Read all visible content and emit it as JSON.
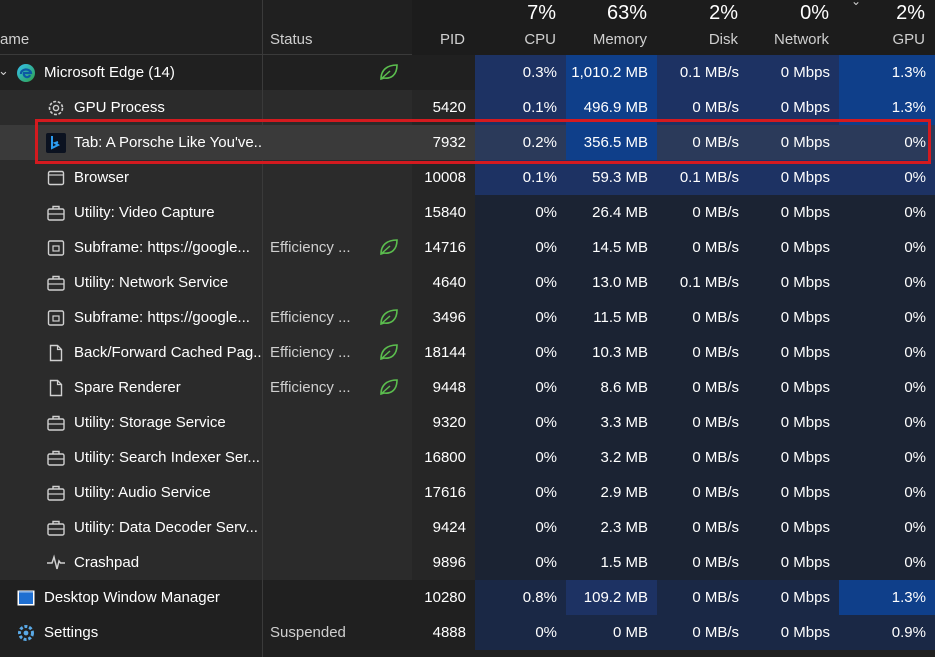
{
  "columns": {
    "name": {
      "label": "ame"
    },
    "status": {
      "label": "Status"
    },
    "pid": {
      "label": "PID"
    },
    "cpu": {
      "label": "CPU",
      "percent": "7%"
    },
    "memory": {
      "label": "Memory",
      "percent": "63%"
    },
    "disk": {
      "label": "Disk",
      "percent": "2%"
    },
    "network": {
      "label": "Network",
      "percent": "0%"
    },
    "gpu": {
      "label": "GPU",
      "percent": "2%"
    }
  },
  "colors": {
    "background": "#202020",
    "heat_light": "#1a2845",
    "heat_medium": "#1d3263",
    "heat_strong": "#0f3f8a",
    "highlight_box": "#d41a1f",
    "leaf_green": "#5bbd4e"
  },
  "processes": [
    {
      "name": "Microsoft Edge (14)",
      "status": "",
      "status_icon": "leaf-icon",
      "pid": "",
      "cpu": "0.3%",
      "memory": "1,010.2 MB",
      "disk": "0.1 MB/s",
      "network": "0 Mbps",
      "gpu": "1.3%",
      "icon": "edge-icon",
      "level": 0,
      "expanded": true,
      "heat": {
        "cpu": "medium",
        "memory": "strong",
        "disk": "medium",
        "network": "medium",
        "gpu": "strong"
      }
    },
    {
      "name": "GPU Process",
      "status": "",
      "status_icon": "",
      "pid": "5420",
      "cpu": "0.1%",
      "memory": "496.9 MB",
      "disk": "0 MB/s",
      "network": "0 Mbps",
      "gpu": "1.3%",
      "icon": "gear-icon",
      "level": 1,
      "heat": {
        "cpu": "medium",
        "memory": "strong",
        "disk": "medium",
        "network": "medium",
        "gpu": "strong"
      }
    },
    {
      "name": "Tab: A Porsche Like You've...",
      "status": "",
      "status_icon": "",
      "pid": "7932",
      "cpu": "0.2%",
      "memory": "356.5 MB",
      "disk": "0 MB/s",
      "network": "0 Mbps",
      "gpu": "0%",
      "icon": "bing-icon",
      "level": 1,
      "selected": true,
      "heat": {
        "cpu": "medium",
        "memory": "strong",
        "disk": "medium",
        "network": "medium",
        "gpu": "medium"
      }
    },
    {
      "name": "Browser",
      "status": "",
      "status_icon": "",
      "pid": "10008",
      "cpu": "0.1%",
      "memory": "59.3 MB",
      "disk": "0.1 MB/s",
      "network": "0 Mbps",
      "gpu": "0%",
      "icon": "window-icon",
      "level": 1,
      "heat": {
        "cpu": "medium",
        "memory": "medium",
        "disk": "medium",
        "network": "medium",
        "gpu": "medium"
      }
    },
    {
      "name": "Utility: Video Capture",
      "status": "",
      "status_icon": "",
      "pid": "15840",
      "cpu": "0%",
      "memory": "26.4 MB",
      "disk": "0 MB/s",
      "network": "0 Mbps",
      "gpu": "0%",
      "icon": "toolbox-icon",
      "level": 1
    },
    {
      "name": "Subframe: https://google...",
      "status": "Efficiency ...",
      "status_icon": "leaf-icon",
      "pid": "14716",
      "cpu": "0%",
      "memory": "14.5 MB",
      "disk": "0 MB/s",
      "network": "0 Mbps",
      "gpu": "0%",
      "icon": "subframe-icon",
      "level": 1
    },
    {
      "name": "Utility: Network Service",
      "status": "",
      "status_icon": "",
      "pid": "4640",
      "cpu": "0%",
      "memory": "13.0 MB",
      "disk": "0.1 MB/s",
      "network": "0 Mbps",
      "gpu": "0%",
      "icon": "toolbox-icon",
      "level": 1
    },
    {
      "name": "Subframe: https://google...",
      "status": "Efficiency ...",
      "status_icon": "leaf-icon",
      "pid": "3496",
      "cpu": "0%",
      "memory": "11.5 MB",
      "disk": "0 MB/s",
      "network": "0 Mbps",
      "gpu": "0%",
      "icon": "subframe-icon",
      "level": 1
    },
    {
      "name": "Back/Forward Cached Pag...",
      "status": "Efficiency ...",
      "status_icon": "leaf-icon",
      "pid": "18144",
      "cpu": "0%",
      "memory": "10.3 MB",
      "disk": "0 MB/s",
      "network": "0 Mbps",
      "gpu": "0%",
      "icon": "document-icon",
      "level": 1
    },
    {
      "name": "Spare Renderer",
      "status": "Efficiency ...",
      "status_icon": "leaf-icon",
      "pid": "9448",
      "cpu": "0%",
      "memory": "8.6 MB",
      "disk": "0 MB/s",
      "network": "0 Mbps",
      "gpu": "0%",
      "icon": "document-icon",
      "level": 1
    },
    {
      "name": "Utility: Storage Service",
      "status": "",
      "status_icon": "",
      "pid": "9320",
      "cpu": "0%",
      "memory": "3.3 MB",
      "disk": "0 MB/s",
      "network": "0 Mbps",
      "gpu": "0%",
      "icon": "toolbox-icon",
      "level": 1
    },
    {
      "name": "Utility: Search Indexer Ser...",
      "status": "",
      "status_icon": "",
      "pid": "16800",
      "cpu": "0%",
      "memory": "3.2 MB",
      "disk": "0 MB/s",
      "network": "0 Mbps",
      "gpu": "0%",
      "icon": "toolbox-icon",
      "level": 1
    },
    {
      "name": "Utility: Audio Service",
      "status": "",
      "status_icon": "",
      "pid": "17616",
      "cpu": "0%",
      "memory": "2.9 MB",
      "disk": "0 MB/s",
      "network": "0 Mbps",
      "gpu": "0%",
      "icon": "toolbox-icon",
      "level": 1
    },
    {
      "name": "Utility: Data Decoder Serv...",
      "status": "",
      "status_icon": "",
      "pid": "9424",
      "cpu": "0%",
      "memory": "2.3 MB",
      "disk": "0 MB/s",
      "network": "0 Mbps",
      "gpu": "0%",
      "icon": "toolbox-icon",
      "level": 1
    },
    {
      "name": "Crashpad",
      "status": "",
      "status_icon": "",
      "pid": "9896",
      "cpu": "0%",
      "memory": "1.5 MB",
      "disk": "0 MB/s",
      "network": "0 Mbps",
      "gpu": "0%",
      "icon": "pulse-icon",
      "level": 1
    },
    {
      "name": "Desktop Window Manager",
      "status": "",
      "status_icon": "",
      "pid": "10280",
      "cpu": "0.8%",
      "memory": "109.2 MB",
      "disk": "0 MB/s",
      "network": "0 Mbps",
      "gpu": "1.3%",
      "icon": "dwm-icon",
      "level": 0,
      "heat": {
        "cpu": "light",
        "memory": "medium",
        "disk": "light",
        "network": "light",
        "gpu": "strong"
      }
    },
    {
      "name": "Settings",
      "status": "Suspended",
      "status_icon": "",
      "pid": "4888",
      "cpu": "0%",
      "memory": "0 MB",
      "disk": "0 MB/s",
      "network": "0 Mbps",
      "gpu": "0.9%",
      "icon": "settings-gear-icon",
      "level": 0,
      "heat": {
        "cpu": "light",
        "memory": "light",
        "disk": "light",
        "network": "light",
        "gpu": "light"
      }
    }
  ]
}
